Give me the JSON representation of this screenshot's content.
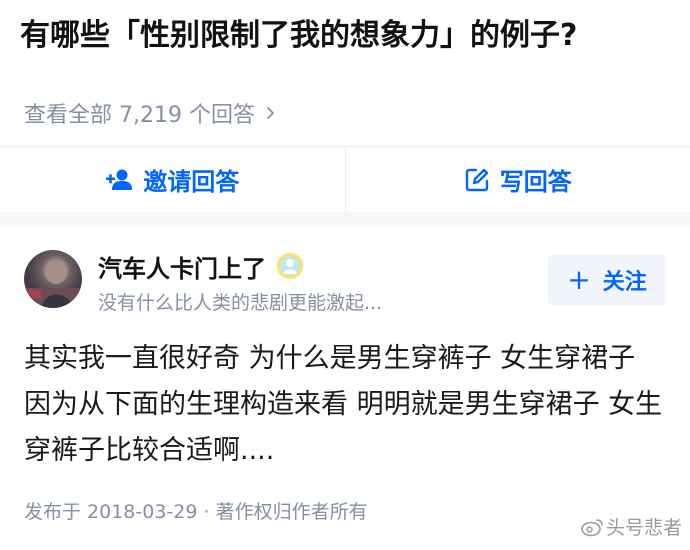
{
  "question": {
    "title": "有哪些「性别限制了我的想象力」的例子?"
  },
  "view_all": {
    "label": "查看全部 7,219 个回答"
  },
  "actions": {
    "invite_label": "邀请回答",
    "write_label": "写回答"
  },
  "author": {
    "name": "汽车人卡门上了",
    "bio": "没有什么比人类的悲剧更能激起...",
    "follow_label": "关注"
  },
  "answer": {
    "text": "其实我一直很好奇 为什么是男生穿裤子 女生穿裙子 因为从下面的生理构造来看 明明就是男生穿裙子 女生穿裤子比较合适啊....",
    "meta": "发布于 2018-03-29 · 著作权归作者所有"
  },
  "watermark": {
    "text": "头号悲者"
  },
  "colors": {
    "accent": "#0066ff",
    "muted": "#8590a6",
    "follow_bg": "#f2f5fb",
    "divider": "#f6f6f6"
  },
  "icons": {
    "invite": "add-user-icon",
    "write": "edit-icon",
    "view_all": "chevron-right-icon",
    "badge": "user-badge-icon",
    "follow": "plus-icon"
  }
}
